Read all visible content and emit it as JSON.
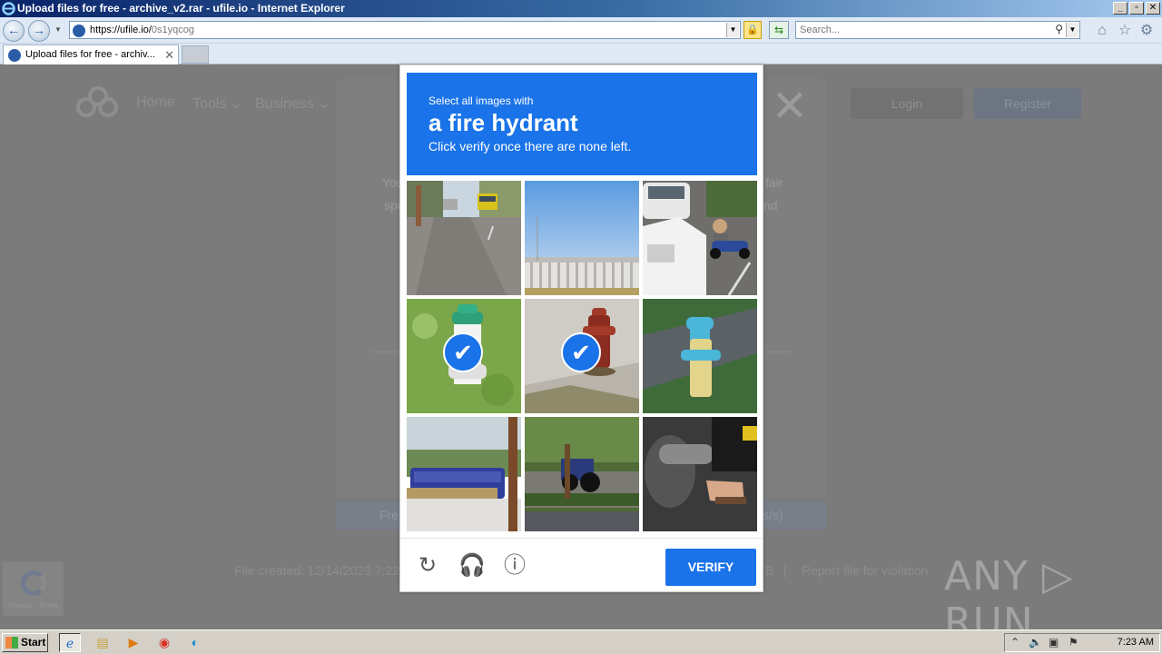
{
  "window": {
    "title": "Upload files for free - archive_v2.rar - ufile.io - Internet Explorer",
    "controls": [
      "_",
      "▫",
      "✕"
    ]
  },
  "browser": {
    "back_icon": "back-arrow-icon",
    "forward_icon": "forward-arrow-icon",
    "address": {
      "prefix": "https://ufile.io/",
      "path": "0s1yqcog"
    },
    "search_placeholder": "Search...",
    "tab_label": "Upload files for free - archiv...",
    "tab_close": "✕"
  },
  "site": {
    "nav": [
      "Home",
      "Tools ⌄",
      "Business ⌄"
    ],
    "login": "Login",
    "register": "Register",
    "card_close": "✕",
    "card_fragments": {
      "left1": "You",
      "left2": "spe",
      "right1": "fair",
      "right2": "nd"
    },
    "download_fragments": {
      "left": "Fre",
      "right": "s/s)"
    },
    "footer_left": "File created: 12/14/2023 7:22",
    "footer_mid": "B",
    "footer_sep": "|",
    "footer_report": "Report file for violation",
    "recaptcha_badge_text": "Privacy - Terms"
  },
  "captcha": {
    "instruction_small": "Select all images with",
    "target": "a fire hydrant",
    "instruction_sub": "Click verify once there are none left.",
    "verify_label": "VERIFY",
    "tiles": [
      {
        "scene": "road-with-bus",
        "selected": false
      },
      {
        "scene": "bridge-and-sky",
        "selected": false
      },
      {
        "scene": "cars-and-motorbike",
        "selected": false
      },
      {
        "scene": "green-hydrant-on-grass",
        "selected": true
      },
      {
        "scene": "red-hydrant-on-pavement",
        "selected": true
      },
      {
        "scene": "blue-yellow-hydrant",
        "selected": false
      },
      {
        "scene": "blue-bus-street",
        "selected": false
      },
      {
        "scene": "tractor-in-park",
        "selected": false
      },
      {
        "scene": "motorbike-closeup",
        "selected": false
      }
    ],
    "footer_icons": [
      "reload-icon",
      "audio-headphones-icon",
      "info-icon"
    ]
  },
  "watermark": "ANY ▷ RUN",
  "taskbar": {
    "start_label": "Start",
    "clock": "7:23 AM"
  }
}
